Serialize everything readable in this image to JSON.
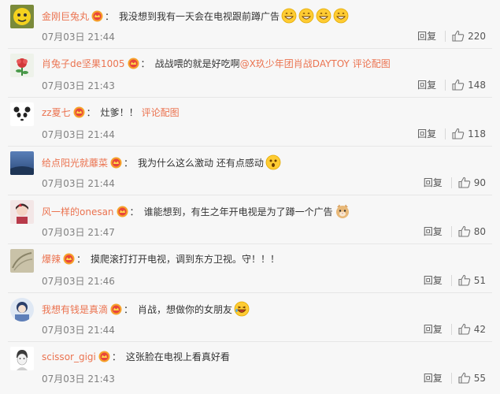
{
  "comments": [
    {
      "user": "金刚巨兔丸",
      "text": "我没想到我有一天会在电视跟前蹲广告",
      "link": "",
      "emoji": [
        "grin",
        "grin",
        "grin",
        "grin"
      ],
      "time": "07月03日 21:44",
      "reply": "回复",
      "likes": "220",
      "avatar": "yellow"
    },
    {
      "user": "肖兔子de坚果1005",
      "text": "战战喂的就是好吃啊",
      "link": "@X玖少年团肖战DAYTOY 评论配图",
      "emoji": [],
      "time": "07月03日 21:43",
      "reply": "回复",
      "likes": "148",
      "avatar": "flower"
    },
    {
      "user": "zz夏七",
      "text": "灶爹！！",
      "link": "评论配图",
      "emoji": [],
      "time": "07月03日 21:44",
      "reply": "回复",
      "likes": "118",
      "avatar": "panda"
    },
    {
      "user": "给点阳光就蘼菜",
      "text": "我为什么这么激动 还有点感动",
      "link": "",
      "emoji": [
        "shock"
      ],
      "time": "07月03日 21:44",
      "reply": "回复",
      "likes": "90",
      "avatar": "blue"
    },
    {
      "user": "风一样的onesan",
      "text": "谁能想到，有生之年开电视是为了蹲一个广告",
      "link": "",
      "emoji": [
        "cat"
      ],
      "time": "07月03日 21:47",
      "reply": "回复",
      "likes": "80",
      "avatar": "girl"
    },
    {
      "user": "爆辣",
      "text": "摸爬滚打打开电视，调到东方卫视。守！！！",
      "link": "",
      "emoji": [],
      "time": "07月03日 21:46",
      "reply": "回复",
      "likes": "51",
      "avatar": "beige"
    },
    {
      "user": "我想有钱是真滴",
      "text": "肖战，想做你的女朋友",
      "link": "",
      "emoji": [
        "laugh"
      ],
      "time": "07月03日 21:44",
      "reply": "回复",
      "likes": "42",
      "avatar": "round"
    },
    {
      "user": "scissor_gigi",
      "text": "这张脸在电视上看真好看",
      "link": "",
      "emoji": [],
      "time": "07月03日 21:43",
      "reply": "回复",
      "likes": "55",
      "avatar": "sketch"
    }
  ]
}
